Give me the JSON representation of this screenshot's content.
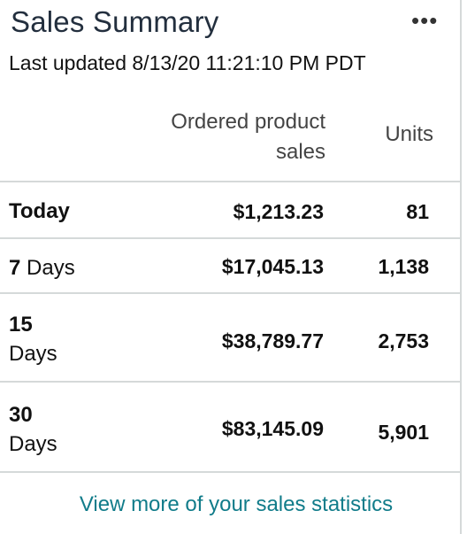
{
  "widget": {
    "title": "Sales Summary",
    "menu_icon": "more-horizontal-icon",
    "menu_glyph": "•••",
    "last_updated": "Last updated 8/13/20 11:21:10 PM PDT"
  },
  "table": {
    "headers": {
      "sales": "Ordered product sales",
      "units": "Units"
    },
    "rows": [
      {
        "label_line1": "Today",
        "label_line2": "",
        "sales": "$1,213.23",
        "units": "81"
      },
      {
        "label_line1": "7",
        "label_line2": "Days",
        "sales": "$17,045.13",
        "units": "1,138"
      },
      {
        "label_line1": "15",
        "label_line2": "Days",
        "sales": "$38,789.77",
        "units": "2,753"
      },
      {
        "label_line1": "30",
        "label_line2": "Days",
        "sales": "$83,145.09",
        "units": "5,901"
      }
    ]
  },
  "footer": {
    "link_text": "View more of your sales statistics",
    "link_color": "#117c8a"
  }
}
